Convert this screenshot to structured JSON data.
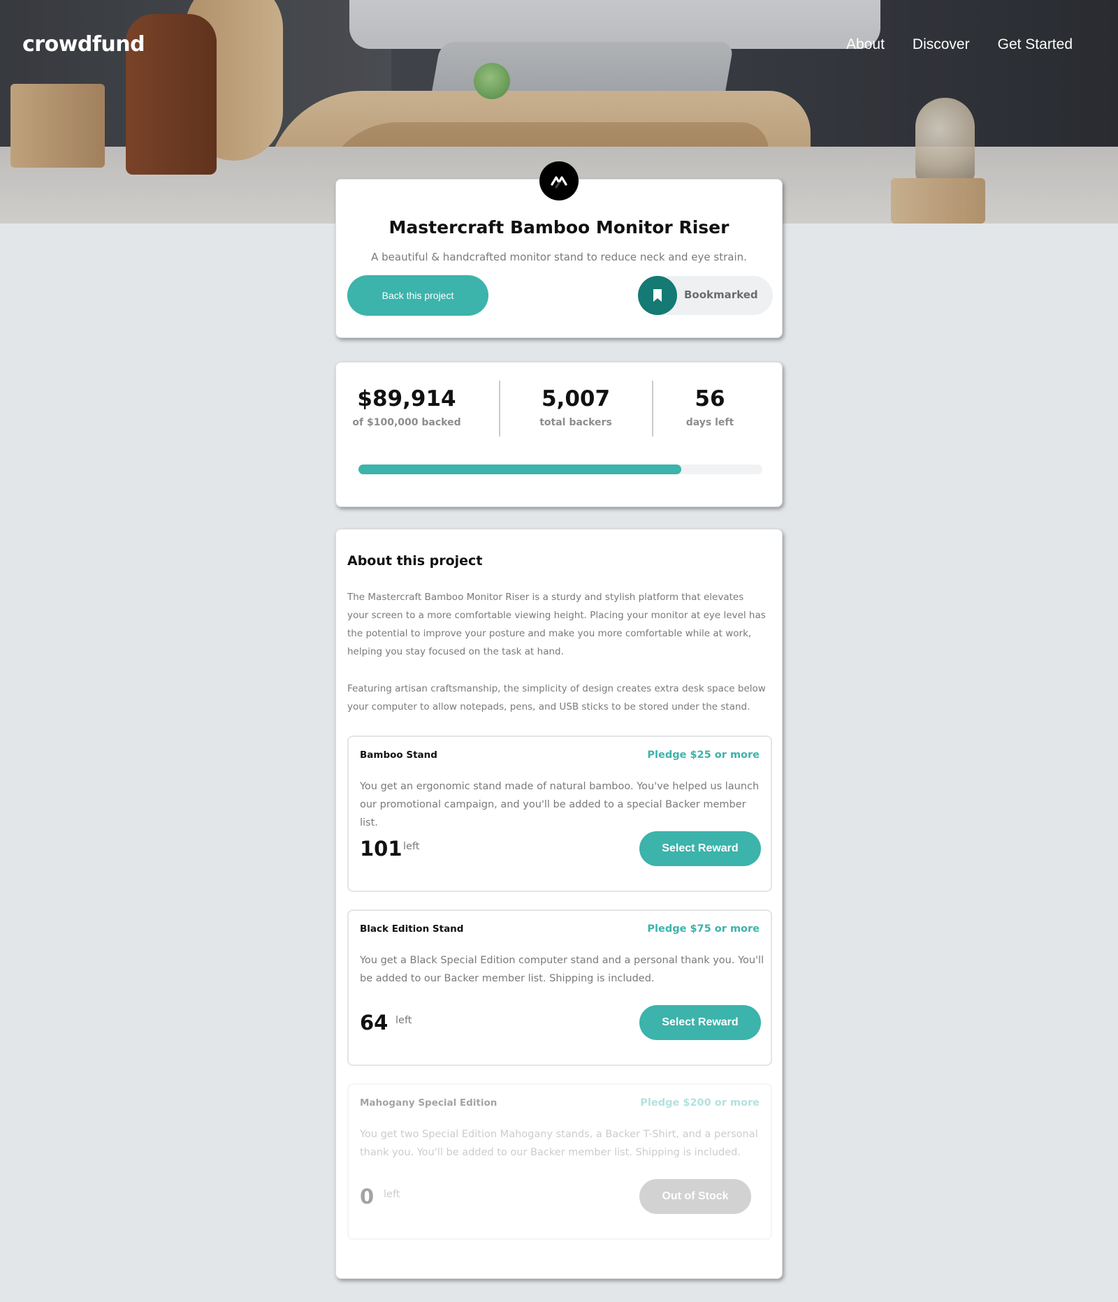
{
  "brand": {
    "logo": "crowdfund"
  },
  "nav": {
    "items": [
      "About",
      "Discover",
      "Get Started"
    ]
  },
  "project": {
    "logo_icon": "mastercraft-logo-icon",
    "title": "Mastercraft Bamboo Monitor Riser",
    "subtitle": "A beautiful & handcrafted monitor stand to reduce neck and eye strain.",
    "back_label": "Back this project",
    "bookmark_label": "Bookmarked",
    "bookmark_icon": "bookmark-icon"
  },
  "stats": {
    "backed_amount": "$89,914",
    "backed_label": "of $100,000 backed",
    "backers": "5,007",
    "backers_label": "total backers",
    "days": "56",
    "days_label": "days left",
    "progress": 0.8
  },
  "about": {
    "title": "About this project",
    "p1": "The Mastercraft Bamboo Monitor Riser is a sturdy and stylish platform that elevates your screen to a more comfortable viewing height. Placing your monitor at eye level has the potential to improve your posture and make you more comfortable while at work, helping you stay focused on the task at hand.",
    "p2": "Featuring artisan craftsmanship, the simplicity of design creates extra desk space below your computer to allow notepads, pens, and USB sticks to be stored under the stand."
  },
  "rewards": [
    {
      "name": "Bamboo Stand",
      "pledge": "Pledge $25 or more",
      "description": "You get an ergonomic stand made of natural bamboo. You've helped us launch our promotional campaign, and you'll be added to a special Backer member list.",
      "count": "101",
      "left_label": "left",
      "button": "Select Reward"
    },
    {
      "name": "Black Edition Stand",
      "pledge": "Pledge $75 or more",
      "description": "You get a Black Special Edition computer stand and a personal thank you. You'll be added to our Backer member list. Shipping is included.",
      "count": "64",
      "left_label": "left",
      "button": "Select Reward"
    },
    {
      "name": "Mahogany Special Edition",
      "pledge": "Pledge $200 or more",
      "description": "You get two Special Edition Mahogany stands, a Backer T-Shirt, and a personal thank you. You'll be added to our Backer member list. Shipping is included.",
      "count": "0",
      "left_label": "left",
      "button": "Out of Stock"
    }
  ],
  "colors": {
    "accent": "#3cb3ab",
    "accent_dark": "#147a73",
    "background": "#e3e6e9"
  }
}
